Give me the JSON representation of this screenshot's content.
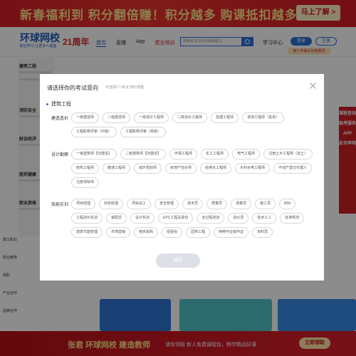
{
  "promo": {
    "text": "新春福利到 积分翻倍赚！积分越多 购课抵扣越多！",
    "cta": "马上了解 >"
  },
  "header": {
    "logo_name": "环球网校",
    "logo_slogan": "职业学习 让更多人受益",
    "anniversary": "21周年",
    "nav": [
      "首页",
      "直播",
      "App",
      "建业培训"
    ],
    "search_placeholder": "搜索考试/老师/课程/图书",
    "study_center": "学习中心",
    "login": "登录",
    "register": "注册",
    "newbie": "新人专属礼包免费领"
  },
  "background": {
    "categories": [
      "建筑工程",
      "消防安全",
      "财会经济",
      "医药健康",
      "职业资格"
    ],
    "side_menu": [
      "建工职业",
      "职业教育",
      "高职",
      "产业合作",
      "品牌合作"
    ],
    "right_ad": [
      "课程咨询",
      "临考服务",
      "APP",
      "反诈声明"
    ],
    "bottom_ad": {
      "title": "张君 环球网校 建造教师",
      "sub": "请你领取 新人免费课程包，畅学精品好课",
      "btn": "立即领取"
    }
  },
  "modal": {
    "title": "请选择你的考试意向",
    "subtitle": "可选择1个考试 随时调整",
    "section": "建筑工程",
    "groups": [
      {
        "label": "建造造价",
        "tags": [
          "一级建造师",
          "二级建造师",
          "一级造价工程师",
          "二级造价工程师",
          "监理工程师",
          "咨询工程师（投资）",
          "工程职称评审（中级）",
          "工程职称评审（高级）"
        ]
      },
      {
        "label": "设计勘察",
        "tags": [
          "一级建筑师【旧建造】",
          "二级建筑师【旧建造】",
          "环保工程师",
          "化工工程师",
          "电气工程师",
          "注册土木工程师（岩土）",
          "结构工程师",
          "暖通工程师",
          "城乡规划师",
          "房地产估价师",
          "给排水工程师",
          "水利水电工程师",
          "不动产登记代理人",
          "注册测绘师"
        ]
      },
      {
        "label": "技能实训",
        "tags": [
          "项目经理",
          "商务经理",
          "项目总工",
          "安全管理",
          "技术员",
          "质量员",
          "测量员",
          "施工员",
          "BIM",
          "工程造价实训",
          "装配式",
          "设计实训",
          "EPC工程总承包",
          "全过程咨询",
          "造价员",
          "技术工人",
          "标准规范",
          "建筑节能管理",
          "市场营销",
          "物资采购",
          "招投标",
          "园林工程",
          "特种作业操作证",
          "资料员"
        ]
      }
    ],
    "submit": "确定"
  },
  "colors": {
    "primary": "#2d6fd8",
    "promo_red": "#d6202a",
    "overlay": "rgba(0,0,0,0.45)"
  }
}
